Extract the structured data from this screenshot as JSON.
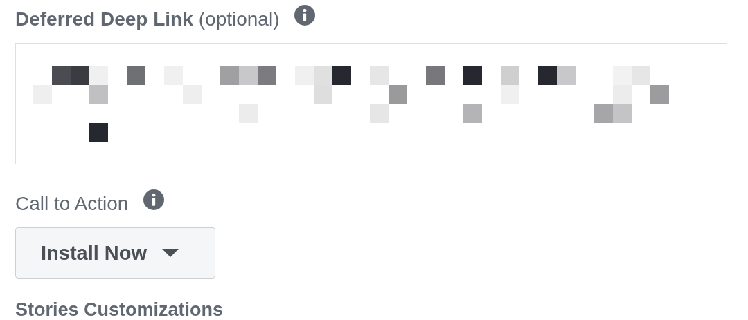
{
  "deep_link": {
    "label": "Deferred Deep Link",
    "hint": "(optional)"
  },
  "call_to_action": {
    "label": "Call to Action",
    "value": "Install Now"
  },
  "next_section": {
    "label": "Stories Customizations"
  }
}
